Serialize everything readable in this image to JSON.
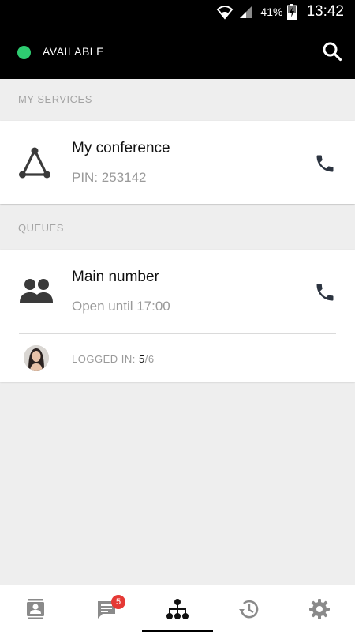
{
  "status_bar": {
    "battery_percent": "41%",
    "time": "13:42",
    "icons": [
      "wifi-icon",
      "signal-icon",
      "battery-charging-icon"
    ]
  },
  "header": {
    "presence_status": "AVAILABLE",
    "presence_color": "#2ecc71",
    "search_icon": "search-icon"
  },
  "my_services": {
    "section_title": "MY SERVICES",
    "conference": {
      "title": "My conference",
      "pin_text": "PIN: 253142",
      "icon": "conference-triangle-icon",
      "action_icon": "phone-icon"
    }
  },
  "queues": {
    "section_title": "QUEUES",
    "main": {
      "title": "Main number",
      "status": "Open until 17:00",
      "icon": "group-icon",
      "action_icon": "phone-icon",
      "logged_in_label": "LOGGED IN: ",
      "logged_in_count": "5",
      "logged_in_total": "/6"
    }
  },
  "bottom_nav": {
    "items": [
      {
        "icon": "contacts-icon",
        "active": false
      },
      {
        "icon": "chat-icon",
        "active": false,
        "badge": "5"
      },
      {
        "icon": "org-chart-icon",
        "active": true
      },
      {
        "icon": "history-icon",
        "active": false
      },
      {
        "icon": "settings-icon",
        "active": false
      }
    ],
    "badge_color": "#e53935"
  }
}
